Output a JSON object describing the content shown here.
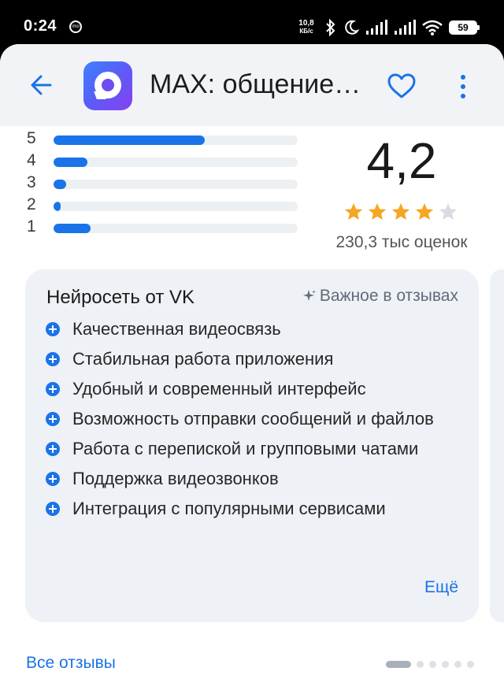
{
  "status_bar": {
    "time": "0:24",
    "speed_top": "10,8",
    "speed_bottom": "КБ/с",
    "battery": "59"
  },
  "app": {
    "title": "MAX: общение и звонки",
    "accent": "#1a73e8"
  },
  "ratings": {
    "bars": [
      {
        "label": "5",
        "fraction": 0.62
      },
      {
        "label": "4",
        "fraction": 0.14
      },
      {
        "label": "3",
        "fraction": 0.05
      },
      {
        "label": "2",
        "fraction": 0.03
      },
      {
        "label": "1",
        "fraction": 0.15
      }
    ],
    "score": "4,2",
    "stars": 4,
    "max_stars": 5,
    "count": "230,3 тыс оценок"
  },
  "summary_card": {
    "title": "Нейросеть от VK",
    "ai_label": "Важное в отзывах",
    "items": [
      "Качественная видеосвязь",
      "Стабильная работа приложения",
      "Удобный и современный интерфейс",
      "Возможность отправки сообщений и файлов",
      "Работа с перепиской и групповыми чатами",
      "Поддержка видеозвонков",
      "Интеграция с популярными сервисами"
    ],
    "more": "Ещё"
  },
  "footer": {
    "all_reviews": "Все отзывы",
    "pages": 6,
    "active_page": 1
  }
}
